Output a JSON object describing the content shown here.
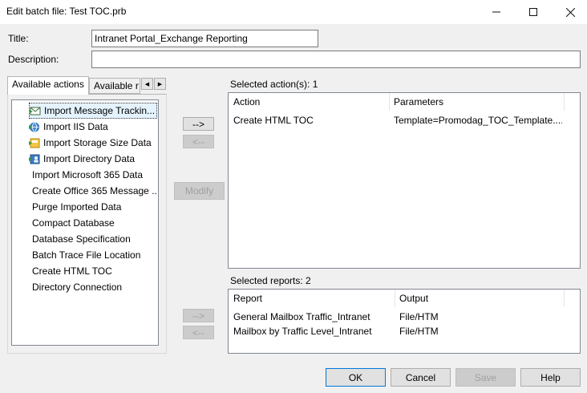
{
  "window": {
    "title": "Edit batch file: Test TOC.prb"
  },
  "form": {
    "title_label": "Title:",
    "title_value": "Intranet Portal_Exchange Reporting",
    "description_label": "Description:",
    "description_value": ""
  },
  "tabs": [
    {
      "label": "Available actions"
    },
    {
      "label": "Available r"
    }
  ],
  "available_actions": [
    {
      "label": "Import Message Trackin...",
      "icon": "mail-import-icon"
    },
    {
      "label": "Import IIS Data",
      "icon": "globe-import-icon"
    },
    {
      "label": "Import Storage Size Data",
      "icon": "storage-import-icon"
    },
    {
      "label": "Import Directory Data",
      "icon": "directory-import-icon"
    },
    {
      "label": "Import Microsoft 365 Data"
    },
    {
      "label": "Create Office 365 Message ..."
    },
    {
      "label": "Purge Imported Data"
    },
    {
      "label": "Compact Database"
    },
    {
      "label": "Database Specification"
    },
    {
      "label": "Batch Trace File Location"
    },
    {
      "label": "Create HTML TOC"
    },
    {
      "label": "Directory Connection"
    }
  ],
  "buttons": {
    "add_action": "-->",
    "remove_action": "<--",
    "modify": "Modify",
    "add_report": "-->",
    "remove_report": "<--",
    "ok": "OK",
    "cancel": "Cancel",
    "save": "Save",
    "help": "Help"
  },
  "selected_actions": {
    "label": "Selected action(s): 1",
    "columns": [
      "Action",
      "Parameters"
    ],
    "rows": [
      {
        "action": "Create HTML TOC",
        "parameters": "Template=Promodag_TOC_Template...."
      }
    ]
  },
  "selected_reports": {
    "label": "Selected reports: 2",
    "columns": [
      "Report",
      "Output"
    ],
    "rows": [
      {
        "report": "General Mailbox Traffic_Intranet",
        "output": "File/HTM"
      },
      {
        "report": "Mailbox by Traffic Level_Intranet",
        "output": "File/HTM"
      }
    ]
  }
}
